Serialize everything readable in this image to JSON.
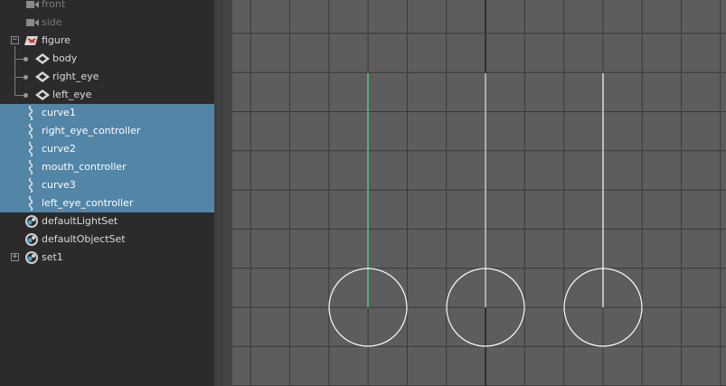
{
  "outliner": {
    "items": [
      {
        "label": "front",
        "icon": "camera-icon",
        "dim": true
      },
      {
        "label": "side",
        "icon": "camera-icon",
        "dim": true
      },
      {
        "label": "figure",
        "icon": "group-transform-icon",
        "expander": "−"
      },
      {
        "label": "body",
        "icon": "nurbs-shape-icon"
      },
      {
        "label": "right_eye",
        "icon": "nurbs-shape-icon"
      },
      {
        "label": "left_eye",
        "icon": "nurbs-shape-icon"
      },
      {
        "label": "curve1",
        "icon": "curve-icon",
        "selected": true
      },
      {
        "label": "right_eye_controller",
        "icon": "curve-icon",
        "selected": true
      },
      {
        "label": "curve2",
        "icon": "curve-icon",
        "selected": true
      },
      {
        "label": "mouth_controller",
        "icon": "curve-icon",
        "selected": true
      },
      {
        "label": "curve3",
        "icon": "curve-icon",
        "selected": true
      },
      {
        "label": "left_eye_controller",
        "icon": "curve-icon",
        "selected": true
      },
      {
        "label": "defaultLightSet",
        "icon": "set-icon"
      },
      {
        "label": "defaultObjectSet",
        "icon": "set-icon"
      },
      {
        "label": "set1",
        "icon": "set-icon",
        "expander": "+"
      }
    ]
  },
  "viewport": {
    "grid_color": "#3a3a3a",
    "axis_color": "#2f2f2f",
    "background": "#5d5d5d",
    "curve_color": "#ffffff",
    "active_curve_color": "#5fe08a"
  }
}
